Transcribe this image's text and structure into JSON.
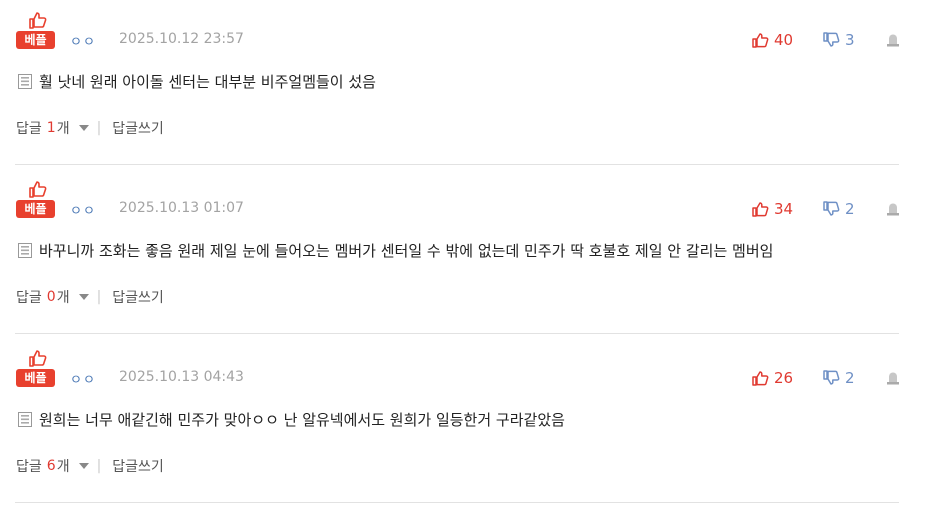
{
  "best_label": "베플",
  "reply_label": "답글",
  "reply_unit": "개",
  "write_reply_label": "답글쓰기",
  "colors": {
    "accent_red": "#e8402e",
    "like_red": "#e03a31",
    "dislike_blue": "#6f90c5",
    "nick_blue": "#4a78b5",
    "date_gray": "#a3a3a3"
  },
  "icons": {
    "best": "thumbs-up-icon",
    "like": "thumbs-up-icon",
    "dislike": "thumbs-down-icon",
    "report": "report-icon",
    "body": "document-icon",
    "expand": "caret-down-icon"
  },
  "comments": [
    {
      "nickname": "ㅇㅇ",
      "date": "2025.10.12 23:57",
      "likes": "40",
      "dislikes": "3",
      "text": "훨 낫네 원래 아이돌 센터는 대부분 비주얼멤들이 섰음",
      "reply_count": "1"
    },
    {
      "nickname": "ㅇㅇ",
      "date": "2025.10.13 01:07",
      "likes": "34",
      "dislikes": "2",
      "text": "바꾸니까 조화는 좋음 원래 제일 눈에 들어오는 멤버가 센터일 수 밖에 없는데 민주가 딱 호불호 제일 안 갈리는 멤버임",
      "reply_count": "0"
    },
    {
      "nickname": "ㅇㅇ",
      "date": "2025.10.13 04:43",
      "likes": "26",
      "dislikes": "2",
      "text": "원희는 너무 애같긴해 민주가 맞아ㅇㅇ 난 알유넥에서도 원희가 일등한거 구라같았음",
      "reply_count": "6"
    }
  ]
}
